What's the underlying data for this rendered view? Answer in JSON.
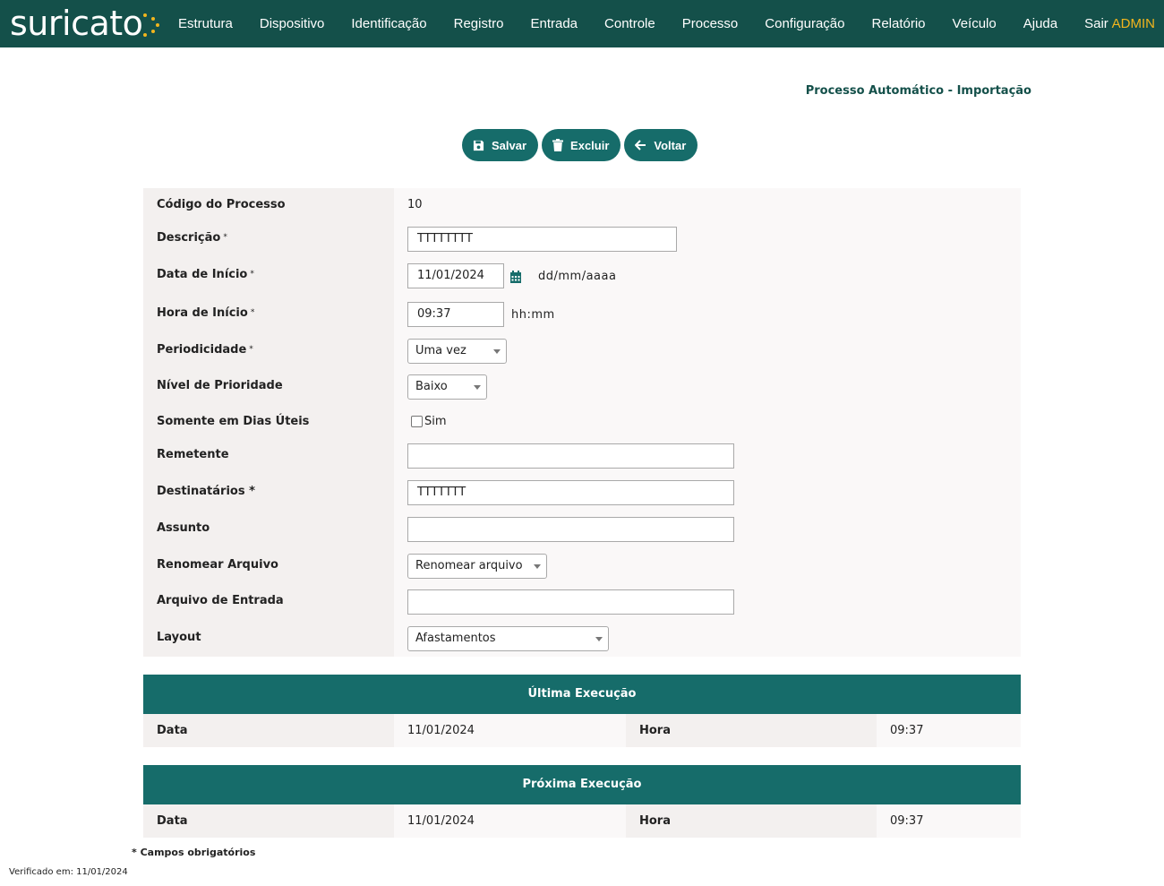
{
  "brand": {
    "name": "suricato",
    "accent": "#f2b51d",
    "nav_bg": "#14504a",
    "button_bg": "#166c6a"
  },
  "nav": {
    "items": [
      "Estrutura",
      "Dispositivo",
      "Identificação",
      "Registro",
      "Entrada",
      "Controle",
      "Processo",
      "Configuração",
      "Relatório",
      "Veículo",
      "Ajuda",
      "Sair"
    ],
    "user": "ADMIN"
  },
  "page": {
    "title": "Processo Automático - Importação"
  },
  "toolbar": {
    "save_label": "Salvar",
    "delete_label": "Excluir",
    "back_label": "Voltar"
  },
  "form": {
    "codigo": {
      "label": "Código do Processo",
      "value": "10"
    },
    "descricao": {
      "label": "Descrição",
      "required": "*",
      "value": "TTTTTTTT"
    },
    "data_inicio": {
      "label": "Data de Início",
      "required": "*",
      "value": "11/01/2024",
      "hint": "dd/mm/aaaa"
    },
    "hora_inicio": {
      "label": "Hora de Início",
      "required": "*",
      "value": "09:37",
      "hint": "hh:mm"
    },
    "periodicidade": {
      "label": "Periodicidade",
      "required": "*",
      "value": "Uma vez"
    },
    "prioridade": {
      "label": "Nível de Prioridade",
      "value": "Baixo"
    },
    "dias_uteis": {
      "label": "Somente em Dias Úteis",
      "option": "Sim",
      "checked": false
    },
    "remetente": {
      "label": "Remetente",
      "value": ""
    },
    "destinatarios": {
      "label": "Destinatários *",
      "value": "TTTTTTT"
    },
    "assunto": {
      "label": "Assunto",
      "value": ""
    },
    "renomear": {
      "label": "Renomear Arquivo",
      "value": "Renomear arquivo"
    },
    "arquivo_entrada": {
      "label": "Arquivo de Entrada",
      "value": ""
    },
    "layout": {
      "label": "Layout",
      "value": "Afastamentos"
    }
  },
  "ultima": {
    "title": "Última Execução",
    "data_label": "Data",
    "data": "11/01/2024",
    "hora_label": "Hora",
    "hora": "09:37"
  },
  "proxima": {
    "title": "Próxima Execução",
    "data_label": "Data",
    "data": "11/01/2024",
    "hora_label": "Hora",
    "hora": "09:37"
  },
  "footer": {
    "note": "* Campos obrigatórios",
    "verified": "Verificado em: 11/01/2024"
  }
}
